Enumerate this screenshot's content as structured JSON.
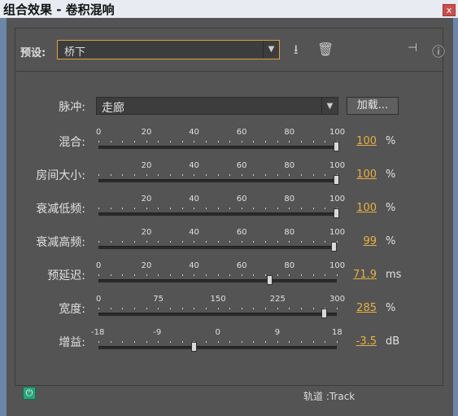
{
  "window": {
    "title": "组合效果 - 卷积混响",
    "close_glyph": "x"
  },
  "preset": {
    "label": "预设:",
    "value": "桥下"
  },
  "toolbar_icons": [
    "save-preset-icon",
    "delete-preset-icon",
    "routing-icon",
    "info-icon"
  ],
  "pulse": {
    "label": "脉冲:",
    "value": "走廊",
    "load_label": "加载..."
  },
  "sliders": [
    {
      "id": "mix",
      "label": "混合:",
      "ticks": [
        "0",
        "20",
        "40",
        "60",
        "80",
        "100"
      ],
      "value_text": "100",
      "unit": "%",
      "min": 0,
      "max": 100,
      "value": 100
    },
    {
      "id": "room-size",
      "label": "房间大小:",
      "ticks": [
        "20",
        "40",
        "60",
        "80",
        "100"
      ],
      "value_text": "100",
      "unit": "%",
      "min": 0,
      "max": 100,
      "value": 100
    },
    {
      "id": "damp-low",
      "label": "衰减低频:",
      "ticks": [
        "20",
        "40",
        "60",
        "80",
        "100"
      ],
      "value_text": "100",
      "unit": "%",
      "min": 0,
      "max": 100,
      "value": 100
    },
    {
      "id": "damp-high",
      "label": "衰减高频:",
      "ticks": [
        "20",
        "40",
        "60",
        "80",
        "100"
      ],
      "value_text": "99",
      "unit": "%",
      "min": 0,
      "max": 100,
      "value": 99
    },
    {
      "id": "predelay",
      "label": "预延迟:",
      "ticks": [
        "0",
        "20",
        "40",
        "60",
        "80",
        "100"
      ],
      "value_text": "71.9",
      "unit": "ms",
      "min": 0,
      "max": 100,
      "value": 71.9
    },
    {
      "id": "width",
      "label": "宽度:",
      "ticks": [
        "0",
        "75",
        "150",
        "225",
        "300"
      ],
      "value_text": "285",
      "unit": "%",
      "min": 0,
      "max": 300,
      "value": 285
    },
    {
      "id": "gain",
      "label": "增益:",
      "ticks": [
        "-18",
        "-9",
        "0",
        "9",
        "18"
      ],
      "value_text": "-3.5",
      "unit": "dB",
      "min": -18,
      "max": 18,
      "value": -3.5
    }
  ],
  "status": {
    "track_label": "轨道 :Track"
  }
}
